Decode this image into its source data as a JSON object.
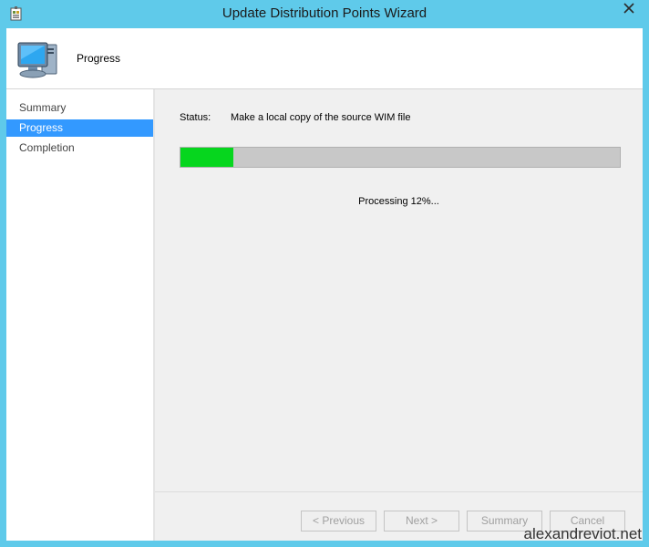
{
  "window": {
    "title": "Update Distribution Points Wizard",
    "close_icon": "close-icon",
    "app_icon": "wizard-app-icon",
    "accent_color": "#5fcaea"
  },
  "header": {
    "title": "Progress",
    "icon": "computer-icon"
  },
  "nav": {
    "items": [
      {
        "label": "Summary",
        "active": false
      },
      {
        "label": "Progress",
        "active": true
      },
      {
        "label": "Completion",
        "active": false
      }
    ],
    "active_color": "#3399ff"
  },
  "status": {
    "label": "Status:",
    "text": "Make a local copy of the source WIM file"
  },
  "progress": {
    "percent": 12,
    "fill_color": "#06d61e",
    "caption": "Processing 12%..."
  },
  "buttons": {
    "previous": "< Previous",
    "next": "Next >",
    "summary": "Summary",
    "cancel": "Cancel"
  },
  "watermark": "alexandreviot.net"
}
